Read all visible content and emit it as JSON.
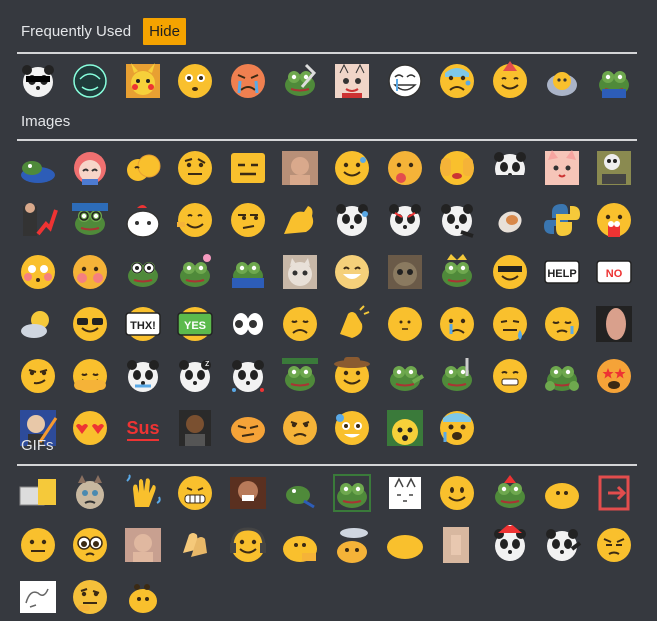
{
  "sections": {
    "frequent": {
      "title": "Frequently Used",
      "hide_label": "Hide"
    },
    "images": {
      "title": "Images"
    },
    "gifs": {
      "title": "GIFs"
    }
  },
  "colors": {
    "background": "#36393f",
    "accent": "#f5a300",
    "divider": "#d4d5d7",
    "emoji_yellow": "#f9c02d"
  },
  "emoji_text": {
    "thx": "THX!",
    "yes": "YES",
    "help": "HELP",
    "no": "NO",
    "sus": "Sus"
  },
  "frequent_icons": [
    "panda-sunglasses",
    "pepe-sketch",
    "pikachu",
    "flushed-face",
    "angry-crying-face",
    "pepe-sword",
    "anime-cat",
    "trollface-crying",
    "sweating-face",
    "party-face",
    "blob-pleading",
    "pepe-sitting"
  ],
  "images_icons": [
    "pepe-lying",
    "anime-girl",
    "kissing-blobs",
    "thinking-eyebrow",
    "expressionless-face",
    "man-photo",
    "sweat-smile-face",
    "thinking-eating",
    "facepalm-hands",
    "panda-peek",
    "anime-cat-girl",
    "skeleton-laptop",
    "suit-man-chart",
    "pepe-glasses",
    "cute-white-creature",
    "blob-shrug",
    "side-eye-face",
    "strong-arm",
    "panda-sweat",
    "panda-angry",
    "panda-point",
    "cat-falling",
    "python-logo",
    "blob-popcorn",
    "blushing-face",
    "hands-face",
    "pepe-fingers",
    "pepe-flower",
    "pepe-computer",
    "crying-cat",
    "laughing-face",
    "cat-stare",
    "pepe-crown",
    "blob-sunglasses",
    "help-sign",
    "no-sign",
    "sun-cloud",
    "sunglasses-face",
    "thx-face",
    "yes-face",
    "eyes",
    "sad-relieved",
    "clapping-blob",
    "neutral-small",
    "crying-tear",
    "sad-sweat",
    "pensive-face",
    "hand-photo",
    "smirk-face",
    "peace-face",
    "panda-hold",
    "panda-sleep",
    "panda-sparkle",
    "pepe-sad",
    "cowboy-face",
    "pepe-pointing",
    "pepe-sword-small",
    "grimacing-face",
    "pepe-hands",
    "star-struck-face",
    "stonks-man",
    "blob-hearts",
    "sus-text",
    "man-laughing",
    "blob-annoyed",
    "grinning-side",
    "hot-sweat-face",
    "pikachu-surprised",
    "fearful-face"
  ],
  "gifs_icons": [
    "typing-cat",
    "grumpy-cat",
    "waving-hand",
    "grinning-teeth",
    "man-laughing-gif",
    "pepe-run",
    "pepe-dance",
    "cat-sketch",
    "smile-face",
    "pepe-party",
    "blob-face",
    "exit-sign",
    "neutral-face",
    "pleading-glasses",
    "man-face",
    "clapping-hands",
    "blob-headphones",
    "blob-peek",
    "blob-sad-cloud",
    "yellow-oval",
    "hand-poke",
    "panda-christmas",
    "panda-dance",
    "sad-pensive",
    "doodle-sketch",
    "thinking-face",
    "blob-dance"
  ]
}
